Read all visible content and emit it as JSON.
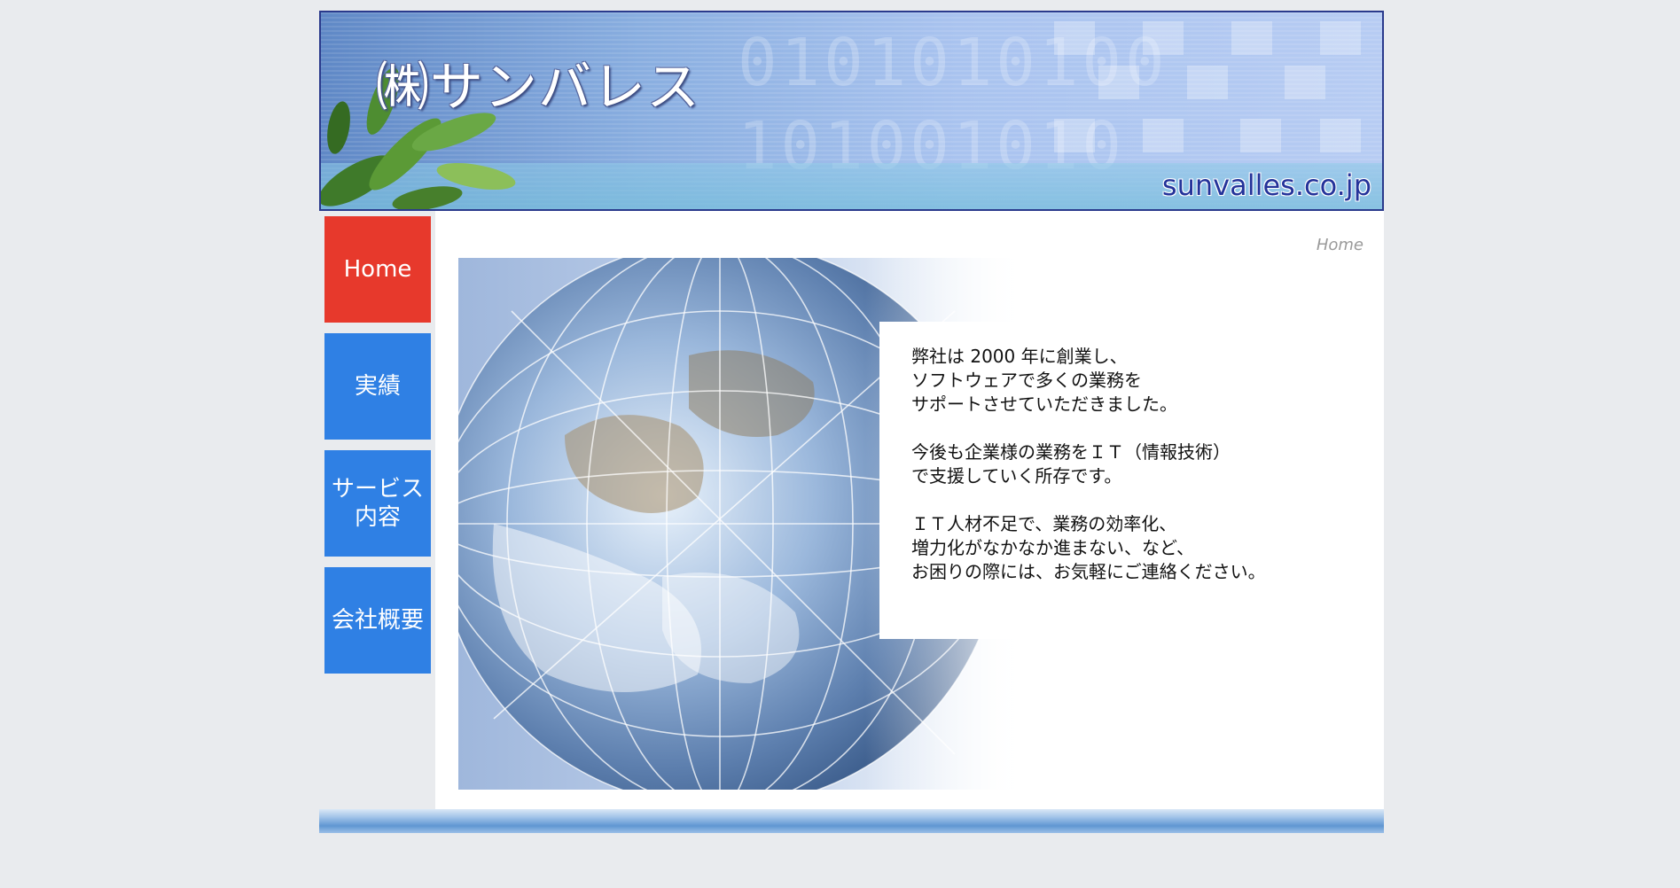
{
  "header": {
    "logo_text": "㈱サンバレス",
    "domain_text": "sunvalles.co.jp"
  },
  "sidebar": {
    "items": [
      {
        "label": "Home",
        "active": true
      },
      {
        "label": "実績",
        "active": false
      },
      {
        "label": "サービス\n内容",
        "active": false
      },
      {
        "label": "会社概要",
        "active": false
      }
    ]
  },
  "main": {
    "breadcrumb": "Home",
    "intro": {
      "paragraph1": "弊社は 2000 年に創業し、\nソフトウェアで多くの業務を\nサポートさせていただきました。",
      "paragraph2": "今後も企業様の業務をＩＴ（情報技術）\nで支援していく所存です。",
      "paragraph3": "ＩＴ人材不足で、業務の効率化、\n増力化がなかなか進まない、など、\nお困りの際には、お気軽にご連絡ください。"
    }
  },
  "colors": {
    "nav_blue": "#2f80e4",
    "nav_active_red": "#e7392c",
    "header_border": "#2a3a8c",
    "page_background": "#e9ebee"
  },
  "icons": {
    "hero_image": "earth-globe",
    "header_plant": "plant-leaves"
  }
}
